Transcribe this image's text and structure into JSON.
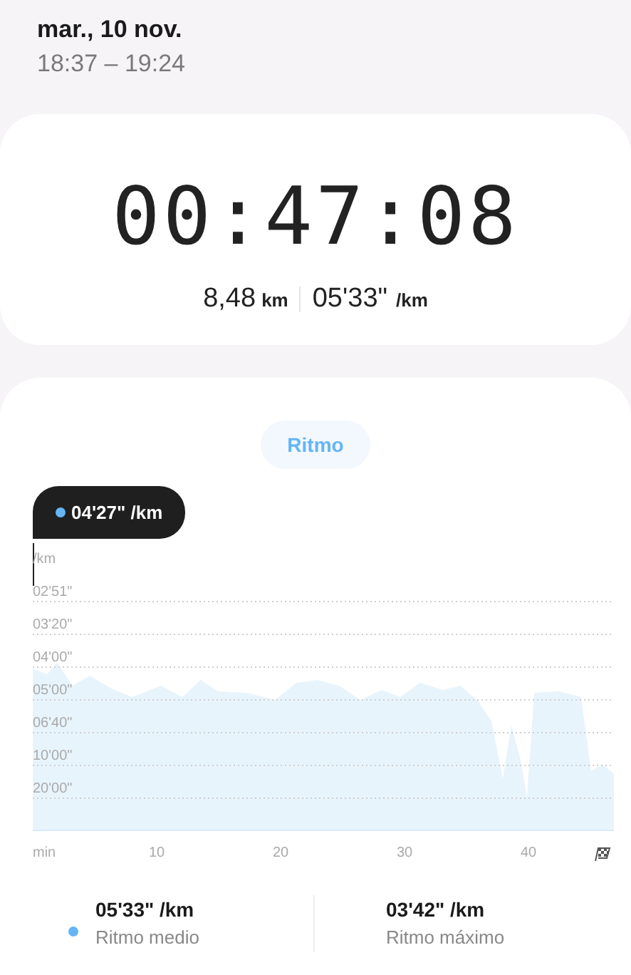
{
  "header": {
    "date": "mar., 10 nov.",
    "time_range": "18:37 – 19:24"
  },
  "summary": {
    "duration": "00:47:08",
    "distance": "8,48",
    "distance_unit": "km",
    "pace": "05'33\"",
    "pace_unit": "/km"
  },
  "pace_chart": {
    "tab": {
      "label": "Ritmo",
      "selected": true
    },
    "tooltip": {
      "value": "04'27\" /km",
      "color": "#64b5f6"
    },
    "y_axis": {
      "unit": "/km",
      "ticks": [
        "02'51\"",
        "03'20\"",
        "04'00\"",
        "05'00\"",
        "06'40\"",
        "10'00\"",
        "20'00\""
      ]
    },
    "x_axis": {
      "unit": "min",
      "ticks": [
        "10",
        "20",
        "30",
        "40"
      ]
    }
  },
  "stats": [
    {
      "value": "05'33\" /km",
      "label": "Ritmo medio",
      "color": "#64b5f6"
    },
    {
      "value": "03'42\" /km",
      "label": "Ritmo máximo"
    }
  ]
}
